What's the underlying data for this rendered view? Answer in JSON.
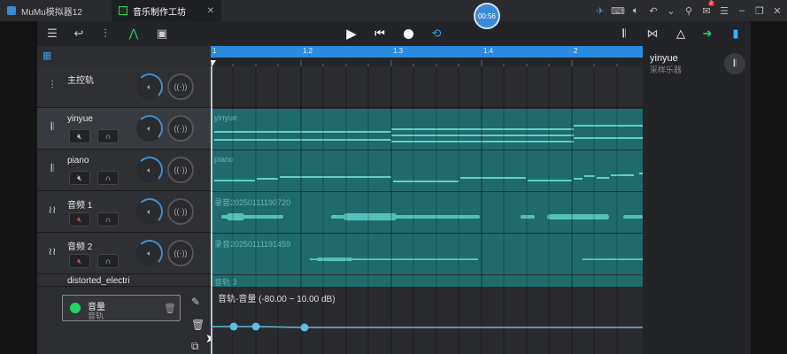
{
  "window": {
    "tabs": [
      {
        "label": "MuMu模拟器12"
      },
      {
        "label": "音乐制作工坊"
      }
    ],
    "timer": "00:56",
    "notification_count": "2"
  },
  "toolbar": {
    "left_icons": [
      "menu-icon",
      "undo-icon",
      "mixer-icon",
      "automation-icon",
      "save-icon"
    ],
    "transport_icons": [
      "play-icon",
      "skip-start-icon",
      "record-icon",
      "loop-icon"
    ],
    "right_icons": [
      "piano-keys-icon",
      "metronome-split-icon",
      "metronome-icon",
      "arrow-right-icon",
      "panel-toggle-icon"
    ]
  },
  "ruler": {
    "markers": [
      "1",
      "1.2",
      "1.3",
      "1.4",
      "2"
    ]
  },
  "tracks": [
    {
      "name": "主控轨",
      "icon": "sliders-icon",
      "has_mute": false
    },
    {
      "name": "yinyue",
      "icon": "piano-keys-icon",
      "has_mute": true,
      "muted": false
    },
    {
      "name": "piano",
      "icon": "piano-keys-icon",
      "has_mute": true,
      "muted": false
    },
    {
      "name": "音频 1",
      "icon": "audio-wave-icon",
      "has_mute": true,
      "muted": true
    },
    {
      "name": "音频 2",
      "icon": "audio-wave-icon",
      "has_mute": true,
      "muted": true
    },
    {
      "name": "distorted_electri",
      "icon": "audio-wave-icon",
      "has_mute": false
    }
  ],
  "clips": [
    {
      "label": "yinyue"
    },
    {
      "label": "piano"
    },
    {
      "label": "录音20250111190720"
    },
    {
      "label": "录音20250111191459"
    },
    {
      "label": "音轨 3"
    }
  ],
  "automation": {
    "card_title": "音量",
    "card_subtitle": "音轨",
    "graph_label": "音轨-音量 (-80.00 ~ 10.00 dB)",
    "accent": "#1ed760"
  },
  "inspector": {
    "track_name": "yinyue",
    "instrument": "采样乐器"
  },
  "colors": {
    "ruler": "#2a8be0",
    "clip": "#1f6b6c",
    "note": "#5fd0cb",
    "knob_accent": "#3f8fd0"
  }
}
